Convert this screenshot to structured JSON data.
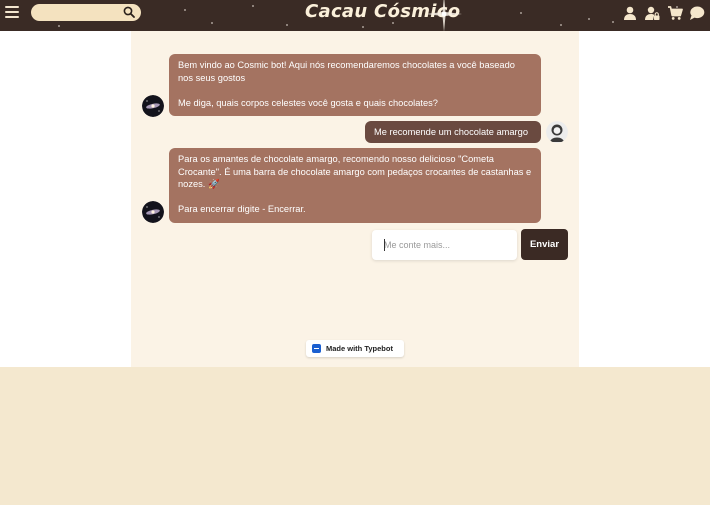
{
  "header": {
    "brand": "Cacau Cósmico",
    "search": {
      "placeholder": "",
      "value": ""
    },
    "icons": [
      "menu-icon",
      "search-icon",
      "user-icon",
      "user-lock-icon",
      "cart-icon",
      "chat-icon"
    ]
  },
  "chat": {
    "messages": [
      {
        "role": "bot",
        "text": "Bem vindo ao Cosmic bot! Aqui nós recomendaremos chocolates a você baseado nos seus gostos\n\nMe diga, quais corpos celestes você gosta e quais chocolates?"
      },
      {
        "role": "user",
        "text": "Me recomende um chocolate amargo"
      },
      {
        "role": "bot",
        "text": "Para os amantes de chocolate amargo, recomendo nosso delicioso \"Cometa Crocante\". É uma barra de chocolate amargo com pedaços crocantes de castanhas e nozes. 🚀\n\nPara encerrar digite - Encerrar."
      }
    ],
    "input": {
      "placeholder": "Me conte mais...",
      "value": ""
    },
    "send_label": "Enviar"
  },
  "footer": {
    "typebot_label": "Made with Typebot"
  },
  "colors": {
    "header_bg": "#3a2b25",
    "bot_bubble": "#a47361",
    "user_bubble": "#6a4a40",
    "send_button": "#3b2a24",
    "page_bg": "#f4e8cf",
    "chat_bg": "#fbf3e6"
  }
}
